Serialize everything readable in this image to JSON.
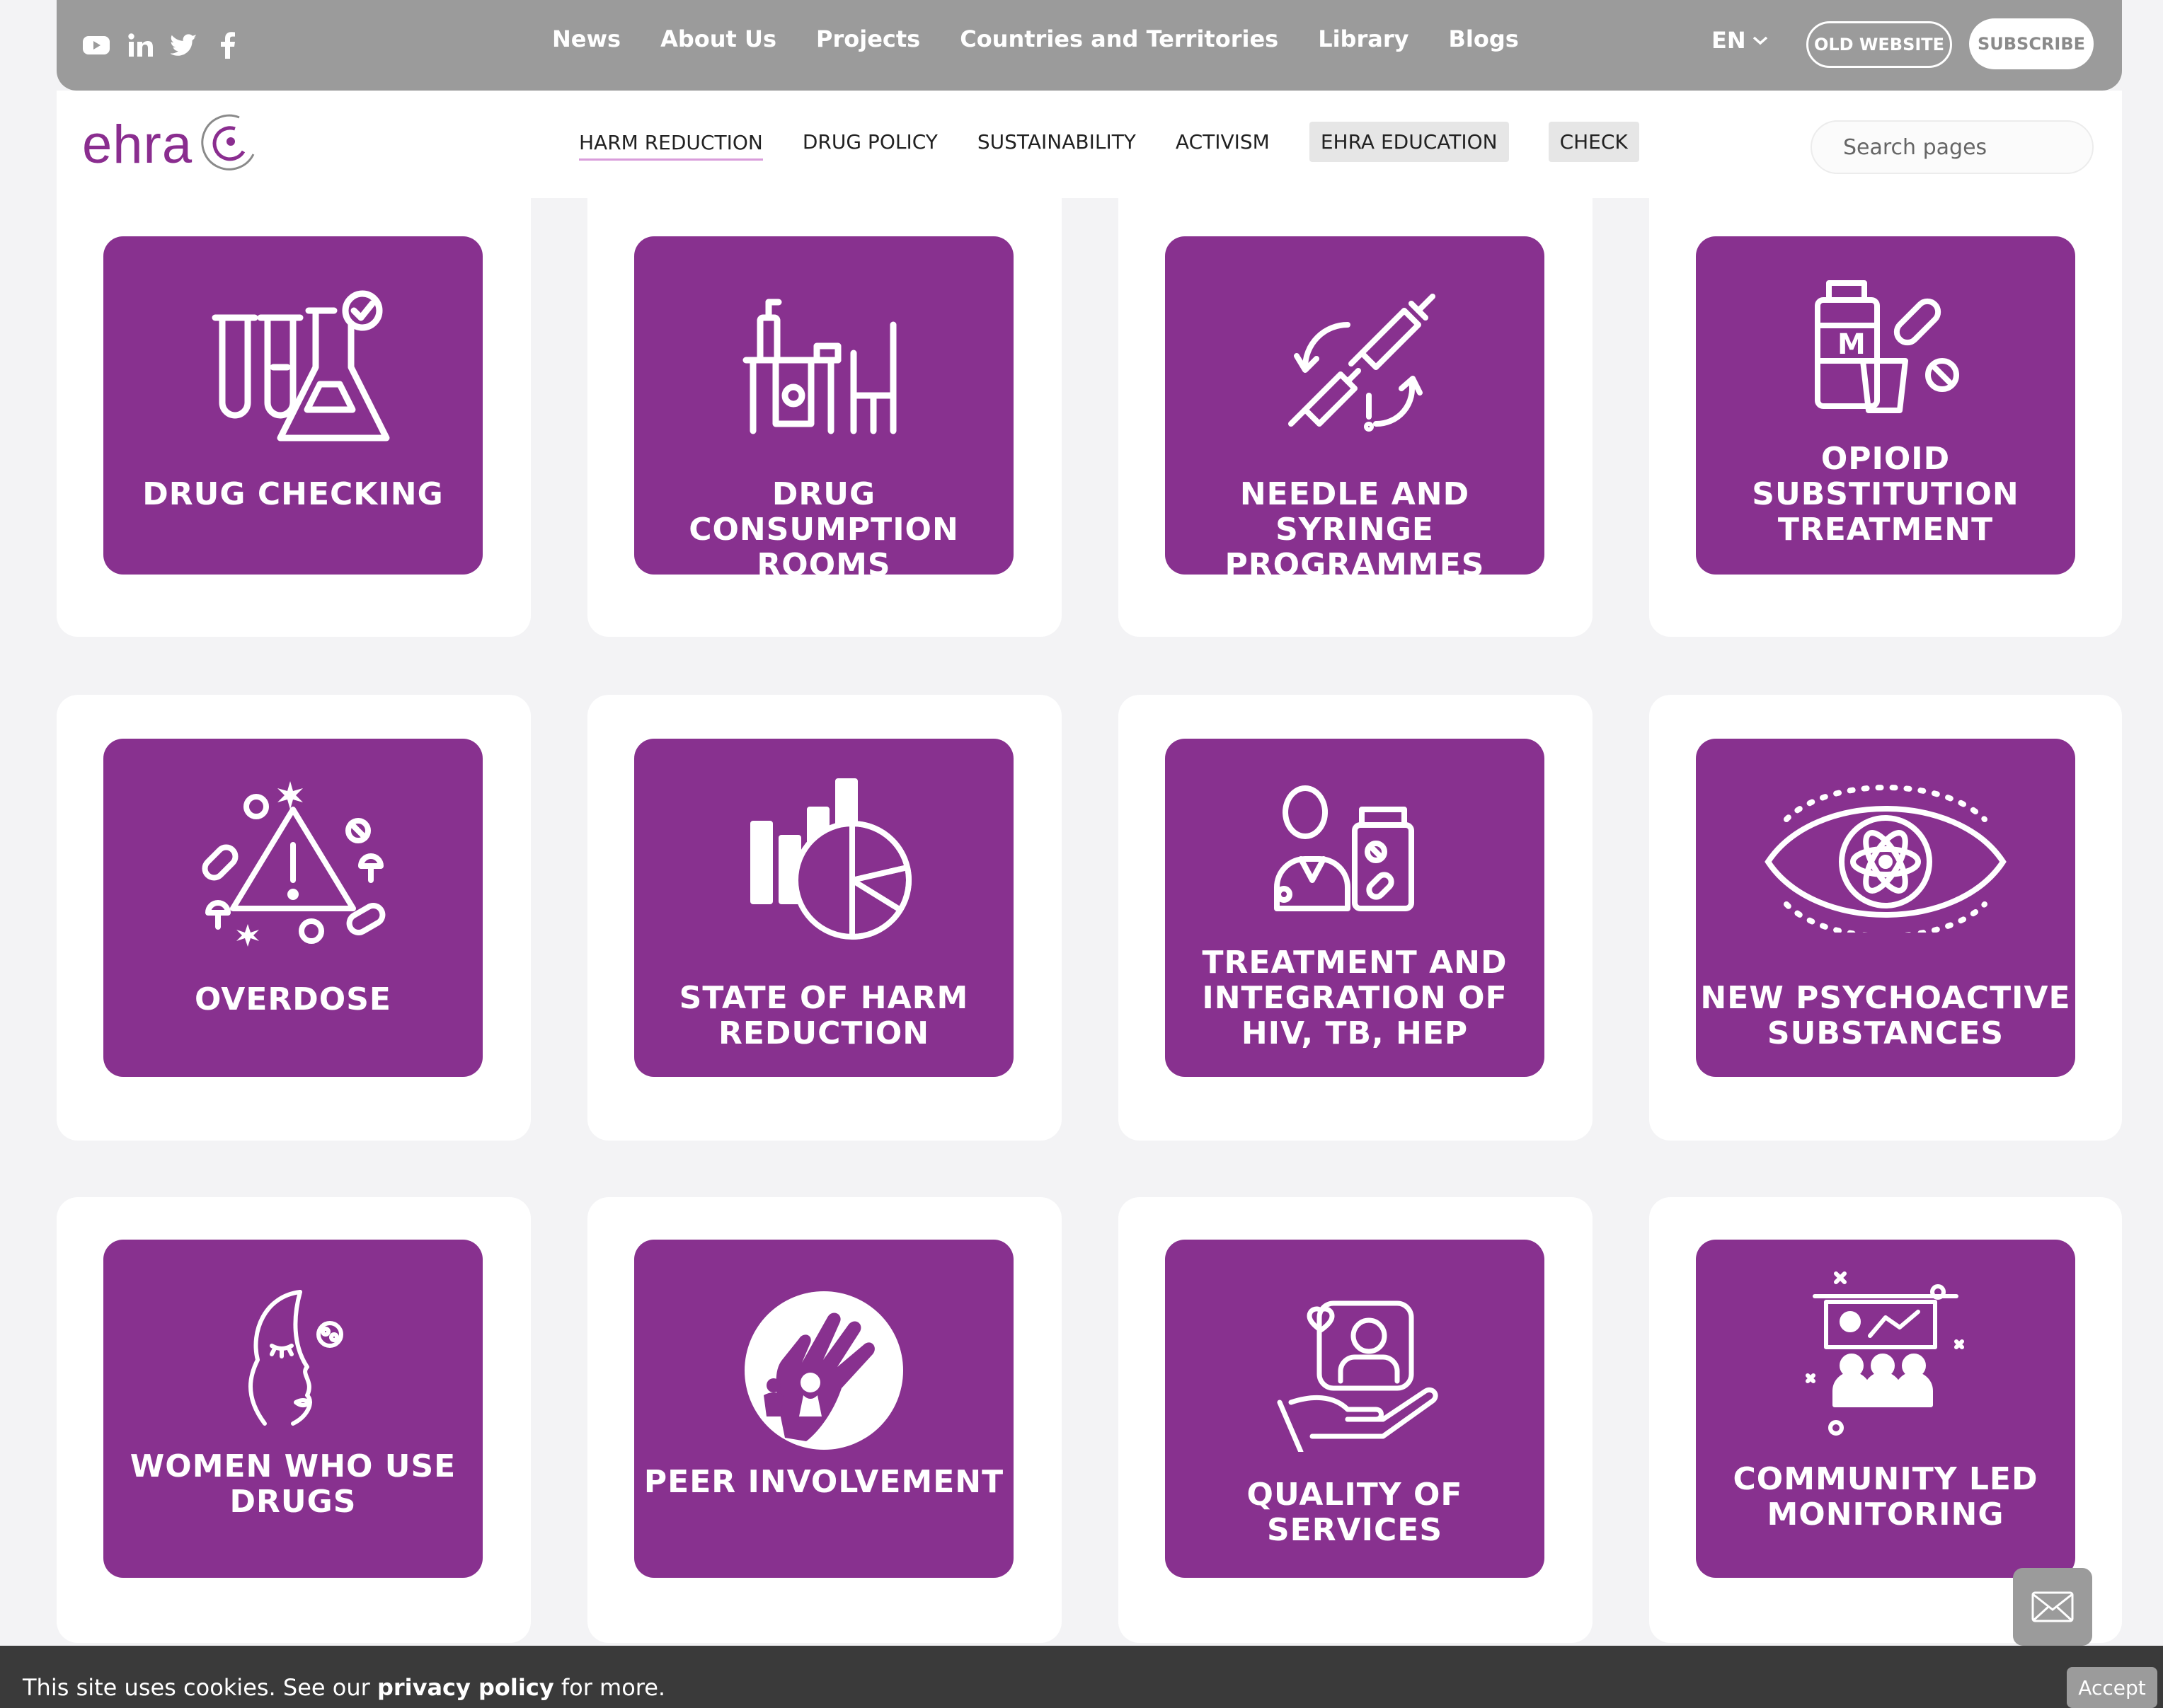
{
  "topbar": {
    "social": [
      "youtube-icon",
      "linkedin-icon",
      "twitter-icon",
      "facebook-icon"
    ],
    "nav": [
      "News",
      "About Us",
      "Projects",
      "Countries and Territories",
      "Library",
      "Blogs"
    ],
    "lang": "EN",
    "old_website": "OLD WEBSITE",
    "subscribe": "SUBSCRIBE"
  },
  "subbar": {
    "logo": "ehra",
    "nav": [
      "HARM REDUCTION",
      "DRUG POLICY",
      "SUSTAINABILITY",
      "ACTIVISM",
      "EHRA EDUCATION",
      "CHECK"
    ],
    "search_placeholder": "Search pages"
  },
  "tiles": [
    {
      "label": "DRUG CHECKING",
      "icon": "test-tubes-flask-icon"
    },
    {
      "label": "DRUG CONSUMPTION ROOMS",
      "icon": "consumption-room-icon"
    },
    {
      "label": "NEEDLE AND SYRINGE PROGRAMMES",
      "icon": "syringe-exchange-icon"
    },
    {
      "label": "OPIOID SUBSTITUTION TREATMENT",
      "icon": "methadone-pills-icon"
    },
    {
      "label": "OVERDOSE",
      "icon": "warning-substances-icon"
    },
    {
      "label": "STATE OF HARM REDUCTION",
      "icon": "bar-pie-chart-icon"
    },
    {
      "label": "TREATMENT AND INTEGRATION OF HIV, TB, HEP",
      "icon": "doctor-medication-icon"
    },
    {
      "label": "NEW PSYCHOACTIVE SUBSTANCES",
      "icon": "eye-atom-icon"
    },
    {
      "label": "WOMEN WHO USE DRUGS",
      "icon": "woman-face-icon"
    },
    {
      "label": "PEER INVOLVEMENT",
      "icon": "peer-hand-icon"
    },
    {
      "label": "QUALITY OF SERVICES",
      "icon": "hand-service-icon"
    },
    {
      "label": "COMMUNITY LED MONITORING",
      "icon": "community-presentation-icon"
    }
  ],
  "cookie": {
    "text_before": "This site uses cookies. See our ",
    "link": "privacy policy",
    "text_after": " for more.",
    "accept": "Accept"
  },
  "colors": {
    "tile": "#88318f",
    "topbar": "#9b9b9b",
    "logo": "#8a2d8f"
  }
}
